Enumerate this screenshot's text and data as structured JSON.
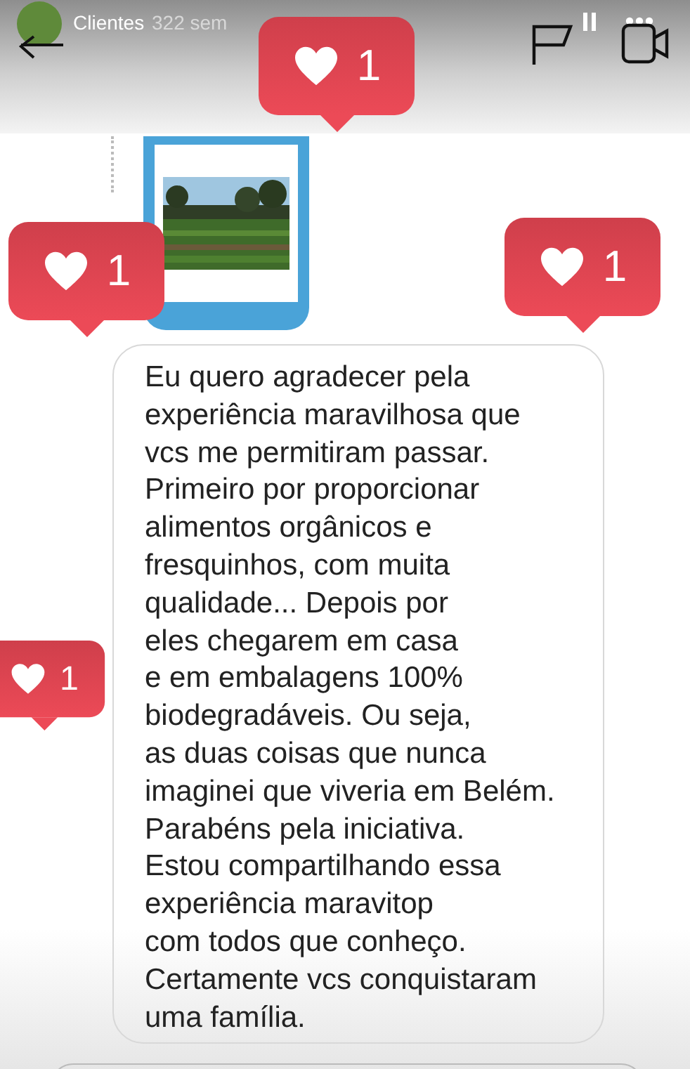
{
  "header": {
    "name": "Clientes",
    "time": "322 sem"
  },
  "message": {
    "lines": [
      "Eu quero agradecer pela",
      "experiência maravilhosa que",
      "vcs me permitiram passar.",
      "Primeiro por proporcionar",
      "alimentos orgânicos e",
      "fresquinhos, com muita",
      "qualidade... Depois por",
      "eles chegarem em casa",
      "e em embalagens 100%",
      "biodegradáveis. Ou seja,",
      "as duas coisas que nunca",
      "imaginei que viveria em Belém.",
      "Parabéns pela iniciativa.",
      "Estou compartilhando essa",
      "experiência maravitop",
      "com todos que conheço.",
      "Certamente vcs conquistaram",
      "uma família."
    ]
  },
  "likes": [
    {
      "count": "1"
    },
    {
      "count": "1"
    },
    {
      "count": "1"
    },
    {
      "count": "1"
    }
  ]
}
